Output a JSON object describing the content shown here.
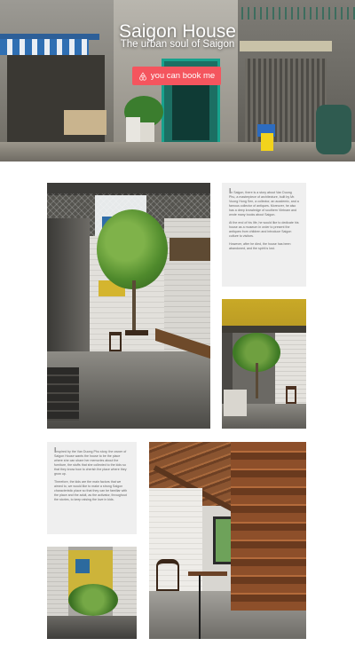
{
  "hero": {
    "title": "Saigon House",
    "subtitle": "The urban soul of Saigon",
    "book_button_label": "you can book me",
    "book_button_icon": "airbnb-logo-icon",
    "accent_color": "#f4555e"
  },
  "story_card_1": {
    "drop_initial": "I",
    "paragraphs": [
      "n Saigon, there is a story about Van Duong Phu, a masterpiece of architecture, built by Mr. Vuong Hong Sen, a collector, an academic, and a famous collector of antiques. Moreover, he also has a deep knowledge of southern Vietnam and wrote many books about Saigon.",
      "At the end of his life, he would like to dedicate his house as a museum in order to present the antiques from children and introduce Saigon culture to visitors.",
      "However, after he died, the house has been abandoned, and the spirit is lost."
    ]
  },
  "story_card_2": {
    "drop_initial": "I",
    "paragraphs": [
      "nspired by the Van Duong Phu story, the owner of Saigon House wants the house to be the place where she can share her memories about the furniture, the stuffs that she collected to the kids so that they know how to cherish the place where they grow up.",
      "Therefore, the kids are the main factors that we aimed to, we would like to make a strong Saigon characteristic place so that they can be familiar with the place and the adult, as the activator, throughout the stories, to keep raising the love in kids."
    ]
  }
}
